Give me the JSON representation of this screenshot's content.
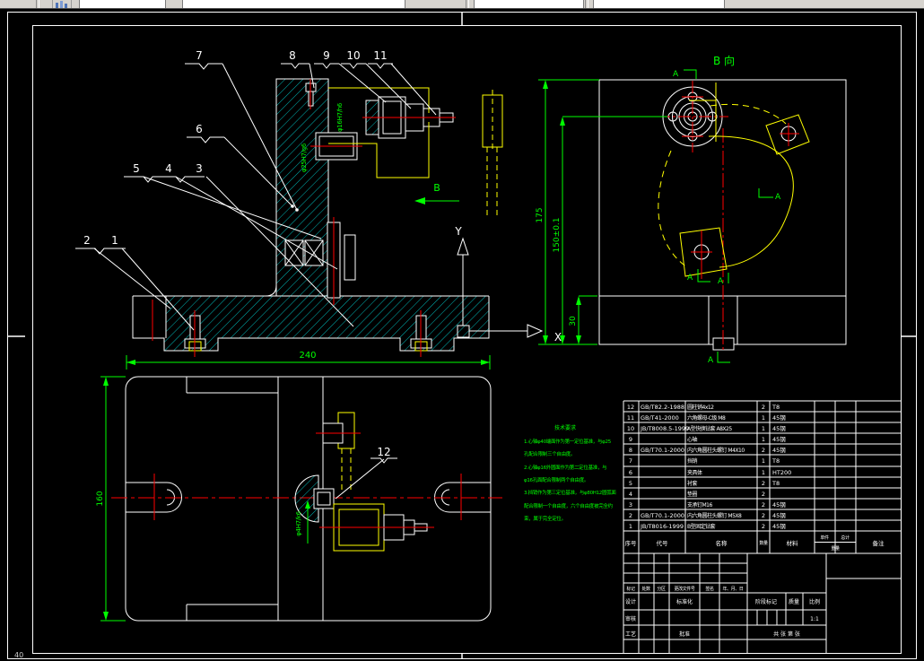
{
  "views": {
    "front": {
      "balloons": [
        "1",
        "2",
        "3",
        "4",
        "5",
        "6",
        "7",
        "8",
        "9",
        "10",
        "11"
      ],
      "fit_labels": [
        "φ16H7/h6",
        "φ25H7/g6"
      ],
      "dim_240": "240",
      "b_arrow": "B"
    },
    "side": {
      "title": "B 向",
      "dim_175": "175",
      "dim_150": "150±0.1",
      "dim_30": "30",
      "section_a": "A"
    },
    "plan": {
      "balloon": "12",
      "dim_160": "160",
      "fit_label": "φ4H7/k6"
    },
    "ucs": {
      "x_label": "X",
      "y_label": "Y"
    }
  },
  "notes": {
    "title": "技术要求",
    "lines": [
      "1.心轴φ40端面作为第一定位基准，与φ25",
      "孔配合限制三个自由度。",
      "2.心轴φ16外圆面作为第二定位基准，与",
      "φ16孔面配合限制两个自由度。",
      "3.挡销作为第三定位基准，与φ80H12圆弧面",
      "配合限制一个自由度，六个自由度被完全约",
      "束，属于完全定位。"
    ]
  },
  "bom": {
    "header": {
      "seq": "序号",
      "code": "代号",
      "name": "名称",
      "qty": "数量",
      "material": "材料",
      "unit": "单件",
      "total": "总计",
      "weight": "重量",
      "remark": "备注"
    },
    "rows": [
      {
        "no": "12",
        "code": "GB/T82.2-1988",
        "name": "圆柱销4x12",
        "qty": "2",
        "mat": "T8"
      },
      {
        "no": "11",
        "code": "GB/T41-2000",
        "name": "六角螺母-C级 M8",
        "qty": "1",
        "mat": "45钢"
      },
      {
        "no": "10",
        "code": "JB/T8008.5-1999",
        "name": "A型快换钻套 A8X25",
        "qty": "1",
        "mat": "45钢"
      },
      {
        "no": "9",
        "code": "",
        "name": "心轴",
        "qty": "1",
        "mat": "45钢"
      },
      {
        "no": "8",
        "code": "GB/T70.1-2000",
        "name": "内六角圆柱头螺钉 M4X10",
        "qty": "2",
        "mat": "45钢"
      },
      {
        "no": "7",
        "code": "",
        "name": "挡销",
        "qty": "1",
        "mat": "T8"
      },
      {
        "no": "6",
        "code": "",
        "name": "夹具体",
        "qty": "1",
        "mat": "HT200"
      },
      {
        "no": "5",
        "code": "",
        "name": "衬套",
        "qty": "2",
        "mat": "T8"
      },
      {
        "no": "4",
        "code": "",
        "name": "垫圈",
        "qty": "2",
        "mat": ""
      },
      {
        "no": "3",
        "code": "",
        "name": "支承钉M16",
        "qty": "2",
        "mat": "45钢"
      },
      {
        "no": "2",
        "code": "GB/T70.1-2000",
        "name": "内六角圆柱头螺钉 M5X8",
        "qty": "2",
        "mat": "45钢"
      },
      {
        "no": "1",
        "code": "JB/T8016-1999",
        "name": "B型固定钻套",
        "qty": "2",
        "mat": "45钢"
      }
    ]
  },
  "title_block": {
    "mark": "标记",
    "count": "处数",
    "zone": "分区",
    "change_doc": "更改文件号",
    "sign": "签名",
    "date": "年、月、日",
    "design": "设计",
    "standardize": "标准化",
    "check": "审核",
    "process": "工艺",
    "approve": "批准",
    "stage_mark": "阶段标记",
    "mass": "质量",
    "scale": "比例",
    "scale_value": "1:1",
    "sheets": "共 张 第 张"
  },
  "window": {
    "corner_text": "40"
  },
  "colors": {
    "background": "#000000",
    "line": "#ffffff",
    "hatch": "#00e6e6",
    "centerline": "#ff0000",
    "workpiece": "#ffff00",
    "annotation": "#00ff00",
    "toolbar": "#d6d3ce"
  }
}
